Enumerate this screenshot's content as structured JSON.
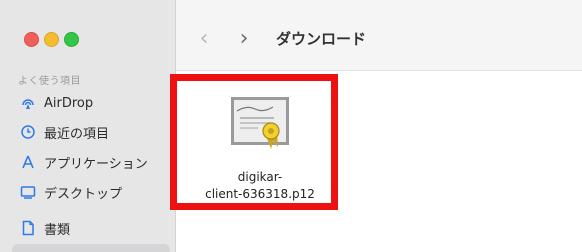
{
  "sidebar": {
    "section_title": "よく使う項目",
    "items": [
      {
        "label": "AirDrop",
        "icon": "airdrop-icon"
      },
      {
        "label": "最近の項目",
        "icon": "clock-icon"
      },
      {
        "label": "アプリケーション",
        "icon": "applications-icon"
      },
      {
        "label": "デスクトップ",
        "icon": "desktop-icon"
      },
      {
        "label": "書類",
        "icon": "document-icon"
      }
    ]
  },
  "toolbar": {
    "back_symbol": "‹",
    "forward_symbol": "›",
    "folder_title": "ダウンロード"
  },
  "file": {
    "name_line1": "digikar-",
    "name_line2": "client-636318.p12",
    "icon": "certificate-icon"
  },
  "colors": {
    "highlight": "#ee1111",
    "accent": "#1a73e8"
  }
}
